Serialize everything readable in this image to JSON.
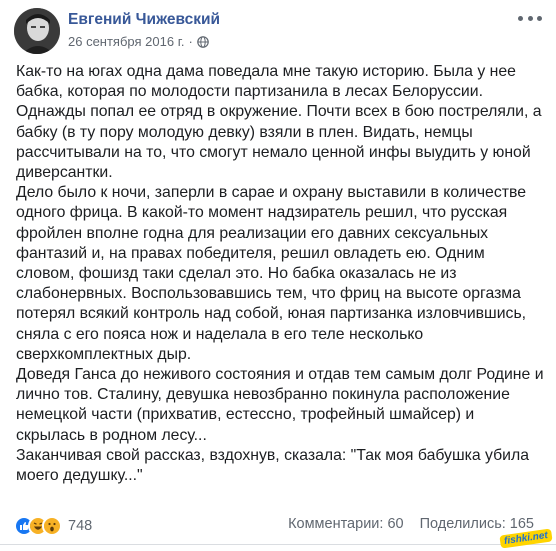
{
  "post": {
    "author": "Евгений Чижевский",
    "date": "26 сентября 2016 г.",
    "separator": "·",
    "privacy_icon": "globe-icon",
    "more_icon": "ellipsis-icon",
    "paragraphs": [
      "Как-то на югах одна дама поведала мне такую историю. Была у нее бабка, которая по молодости партизанила в лесах Белоруссии. Однажды попал ее отряд в окружение. Почти всех в бою постреляли, а бабку (в ту пору молодую девку) взяли в плен. Видать, немцы рассчитывали на то, что смогут немало ценной инфы выудить у юной диверсантки.",
      "Дело было к ночи, заперли в сарае и охрану выставили в количестве одного фрица. В какой-то момент надзиратель решил, что русская фройлен вполне годна для реализации его давних сексуальных фантазий и, на правах победителя, решил овладеть ею. Одним словом, фошизд таки сделал это. Но бабка оказалась не из слабонервных. Воспользовавшись тем, что фриц на высоте оргазма потерял всякий контроль над собой, юная партизанка изловчившись, сняла с его пояса нож и наделала в его теле несколько сверхкомплектных дыр.",
      "Доведя Ганса до неживого состояния и отдав тем самым долг Родине и лично тов. Сталину, девушка невозбранно покинула расположение немецкой части (прихватив, естессно, трофейный шмайсер) и скрылась в родном лесу...",
      "Заканчивая свой рассказ, вздохнув, сказала: \"Так моя бабушка убила моего дедушку...\""
    ]
  },
  "footer": {
    "reaction_icons": [
      "like-icon",
      "haha-icon",
      "wow-icon"
    ],
    "reaction_count": "748",
    "comments": "Комментарии: 60",
    "shares": "Поделились: 165"
  },
  "watermark": "fishki.net",
  "colors": {
    "author": "#385898",
    "meta": "#606770",
    "text": "#1c1e21",
    "like": "#1877f2",
    "haha": "#f7b125"
  }
}
